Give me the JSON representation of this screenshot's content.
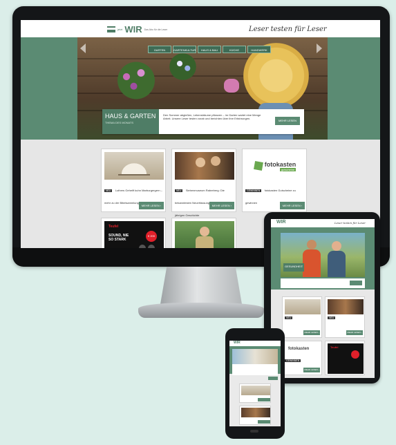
{
  "site": {
    "logo_text": "WIR",
    "logo_prefix": "jetzt",
    "logo_sub": "Das Abo für die Leser",
    "slogan": "Leser testen für Leser"
  },
  "nav": {
    "items": [
      "GARTEN",
      "GARTENKULTUR",
      "HAUS & BAU",
      "KÜCHE",
      "HANDWERK"
    ]
  },
  "hero": {
    "title": "HAUS & GARTEN",
    "subtitle": "THEMA DES MONATS",
    "description": "Den Sommer abgießen, Lebensträume pflanzen – im Garten wartet eine Menge Arbeit. Unsere Leser testen vorab und berichten über ihre Erfahrungen.",
    "button": "MEHR LESEN"
  },
  "cards": [
    {
      "badge": "NEU",
      "text": "Luthers Geheift kuhn Marburgergern – mehr zu der Bibelsammlung zum Luthersommer",
      "button": "MEHR LESEN ›"
    },
    {
      "badge": "NEU",
      "text": "Siebenmuseum Rabreberg: Die bekanntesten Neuerfassungen in den 150-jährigen Geschichte",
      "button": "MEHR LESEN ›"
    },
    {
      "badge": "GEWINNEN",
      "text": "fotokasten Gutscheine zu gewinnen",
      "button": "MEHR LESEN ›",
      "brand": "fotokasten",
      "brand_sub": "gutscheine"
    }
  ],
  "ad": {
    "brand": "Teufel",
    "text": "SOUND, NIE SO STARK",
    "price": "€ 209"
  },
  "tablet": {
    "hero_title": "GESUNDHEIT",
    "cards": [
      {
        "badge": "NEU",
        "button": "MEHR LESEN ›"
      },
      {
        "badge": "NEU",
        "button": "MEHR LESEN ›"
      },
      {
        "badge": "GEWINNEN",
        "brand": "fotokasten",
        "button": "MEHR LESEN ›"
      }
    ]
  },
  "phone": {
    "logo_text": "WIR"
  },
  "colors": {
    "brand_green": "#5b8b73",
    "nav_green": "#3f6c56",
    "background": "#dbeee9"
  }
}
